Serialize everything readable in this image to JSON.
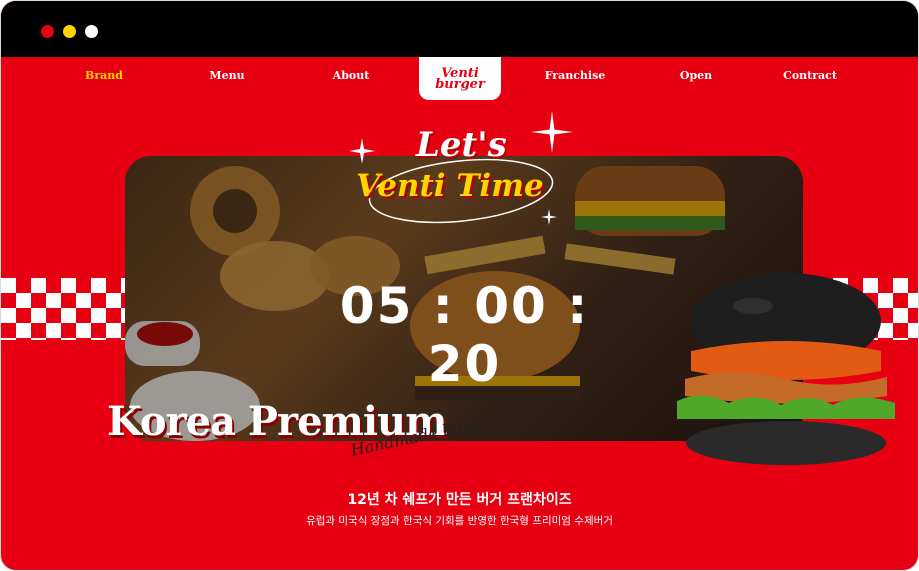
{
  "window": {
    "controls": [
      "close",
      "minimize",
      "maximize"
    ]
  },
  "nav": {
    "items": [
      {
        "label": "Brand",
        "active": true
      },
      {
        "label": "Menu"
      },
      {
        "label": "About"
      },
      {
        "label": "Franchise"
      },
      {
        "label": "Open"
      },
      {
        "label": "Contract"
      }
    ]
  },
  "logo": {
    "line1": "Venti",
    "line2": "burger"
  },
  "hero": {
    "lets": "Let's",
    "venti_time": "Venti Time",
    "timer": "05 : 00 : 20",
    "korea_premium": "Korea Premium",
    "handmade": "Handmade burger",
    "headline": "12년 차 쉐프가 만든 버거 프랜차이즈",
    "subheadline": "유럽과 미국식 장점과 한국식 기회를 반영한 한국형 프리미엄 수제버거"
  },
  "colors": {
    "brand_red": "#e60012",
    "accent_yellow": "#ffd400",
    "titlebar": "#000000"
  },
  "icons": [
    "sparkle-icon",
    "checker-pattern",
    "burger-image",
    "food-photo"
  ]
}
